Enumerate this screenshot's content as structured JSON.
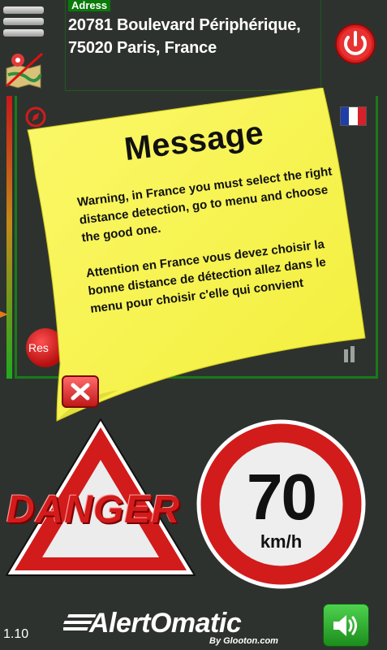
{
  "header": {
    "address_label": "Adress",
    "address_line1": "20781 Boulevard Périphérique,",
    "address_line2": "75020 Paris, France"
  },
  "icons": {
    "menu": "menu-icon",
    "map_off": "map-off-icon",
    "power": "power-icon",
    "compass": "compass-icon",
    "flag": "france-flag-icon",
    "close": "close-x-icon",
    "sound": "speaker-icon"
  },
  "colors": {
    "background": "#2e322f",
    "note_yellow": "#f7f44e",
    "panel_green": "#1a7a1a",
    "danger_red": "#d21b1b",
    "button_green": "#2fb02f"
  },
  "radar": {
    "reset_label": "Res"
  },
  "message": {
    "title": "Message",
    "text_en": "Warning, in France you must select the right distance detection, go to menu and choose the good one.",
    "text_fr": "Attention en France vous devez choisir la bonne distance de détection allez dans le menu pour choisir c'elle qui convient"
  },
  "alert": {
    "danger_text": "DANGER",
    "speed_value": "70",
    "speed_unit": "km/h"
  },
  "footer": {
    "version": "1.10",
    "brand": "AlertOmatic",
    "brand_sub": "By Glooton.com"
  }
}
